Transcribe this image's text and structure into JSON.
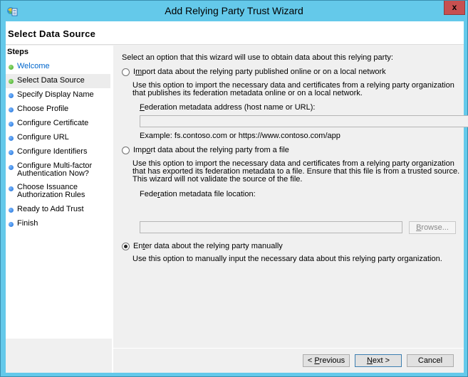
{
  "window": {
    "title": "Add Relying Party Trust Wizard",
    "close_label": "x",
    "icon": "adfs-wizard-icon"
  },
  "header": {
    "page_title": "Select Data Source"
  },
  "steps": {
    "heading": "Steps",
    "items": [
      {
        "label": "Welcome",
        "status": "done",
        "link": true
      },
      {
        "label": "Select Data Source",
        "status": "done",
        "active": true
      },
      {
        "label": "Specify Display Name",
        "status": "todo"
      },
      {
        "label": "Choose Profile",
        "status": "todo"
      },
      {
        "label": "Configure Certificate",
        "status": "todo"
      },
      {
        "label": "Configure URL",
        "status": "todo"
      },
      {
        "label": "Configure Identifiers",
        "status": "todo"
      },
      {
        "label": "Configure Multi-factor\nAuthentication Now?",
        "status": "todo"
      },
      {
        "label": "Choose Issuance\nAuthorization Rules",
        "status": "todo"
      },
      {
        "label": "Ready to Add Trust",
        "status": "todo"
      },
      {
        "label": "Finish",
        "status": "todo"
      }
    ]
  },
  "main": {
    "intro": "Select an option that this wizard will use to obtain data about this relying party:",
    "options": [
      {
        "label_pre": "I",
        "label_accel": "m",
        "label_post": "port data about the relying party published online or on a local network",
        "checked": false,
        "description": "Use this option to import the necessary data and certificates from a relying party organization\nthat publishes its federation metadata online or on a local network.",
        "field_label_accel": "F",
        "field_label_post": "ederation metadata address (host name or URL):",
        "field_value": "",
        "example": "Example: fs.contoso.com or https://www.contoso.com/app"
      },
      {
        "label_pre": "Imp",
        "label_accel": "o",
        "label_post": "rt data about the relying party from a file",
        "checked": false,
        "description": "Use this option to import the necessary data and certificates from a relying party organization\nthat has exported its federation metadata to a file. Ensure that this file is from a trusted source.\nThis wizard will not validate the source of the file.",
        "field_label_pre": "Fede",
        "field_label_accel": "r",
        "field_label_post": "ation metadata file location:",
        "field_value": "",
        "browse_accel": "B",
        "browse_post": "rowse..."
      },
      {
        "label_pre": "En",
        "label_accel": "t",
        "label_post": "er data about the relying party manually",
        "checked": true,
        "description": "Use this option to manually input the necessary data about this relying party organization."
      }
    ]
  },
  "footer": {
    "previous_pre": "< ",
    "previous_accel": "P",
    "previous_post": "revious",
    "next_accel": "N",
    "next_post": "ext >",
    "cancel": "Cancel"
  }
}
